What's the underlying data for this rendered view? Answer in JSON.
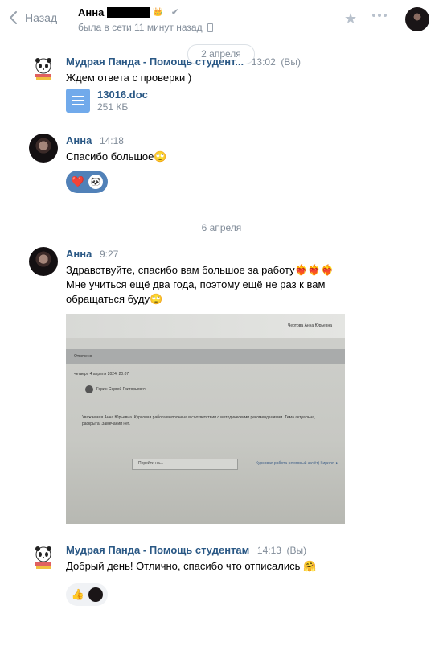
{
  "header": {
    "back_label": "Назад",
    "peer_name": "Анна",
    "status": "была в сети 11 минут назад"
  },
  "dates": [
    "2 апреля",
    "6 апреля"
  ],
  "messages": [
    {
      "author": "Мудрая Панда - Помощь студентам",
      "author_short": "Мудрая Панда - Помощь студент...",
      "time": "13:02",
      "tag": "(Вы)",
      "text": "Ждем ответа с проверки )",
      "file": {
        "name": "13016.doc",
        "size": "251 КБ"
      }
    },
    {
      "author": "Анна",
      "time": "14:18",
      "text": "Спасибо большое🙄"
    },
    {
      "author": "Анна",
      "time": "9:27",
      "lines": [
        "Здравствуйте, спасибо вам большое за работу❤️‍🔥❤️‍🔥❤️‍🔥",
        "Мне учиться ещё два года, поэтому ещё не раз к вам",
        "обращаться буду🙄"
      ]
    },
    {
      "author": "Мудрая Панда - Помощь студентам",
      "time": "14:13",
      "tag": "(Вы)",
      "text": "Добрый день! Отлично, спасибо что отписались 🤗"
    }
  ],
  "photo": {
    "top_text": "Чертова Анна Юрьевна",
    "label_a": "Отвечено",
    "label_b": "четверг, 4 апреля 2024, 20:07",
    "label_c": "Горин Сергей Григорьевич",
    "body_1": "Уважаемая Анна Юрьевна. Курсовая работа выполнена в соответствии с методическими рекомендациями. Тема актуальна,",
    "body_2": "раскрыта. Замечаний нет.",
    "select": "Перейти на...",
    "link": "Курсовая работа (итоговый зачёт) Кирилл ►"
  },
  "colors": {
    "link": "#2a5885",
    "muted": "#818c99",
    "accent": "#5181b8",
    "file": "#71aaeb"
  }
}
